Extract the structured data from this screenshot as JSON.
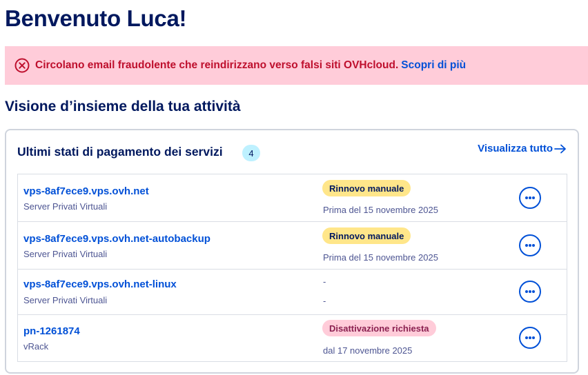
{
  "greeting": "Benvenuto Luca!",
  "alert": {
    "message": "Circolano email fraudolente che reindirizzano verso falsi siti OVHcloud.",
    "link": "Scopri di più",
    "color": "#be0f2d",
    "background": "#ffccd9",
    "icon": "error-circle-x-icon"
  },
  "section_title": "Visione d’insieme della tua attività",
  "payments_card": {
    "title": "Ultimi stati di pagamento dei servizi",
    "count": "4",
    "view_all": "Visualizza tutto",
    "rows": [
      {
        "name": "vps-8af7ece9.vps.ovh.net",
        "type": "Server Privati Virtuali",
        "status": "Rinnovo manuale",
        "status_color": "#ffe68a",
        "date": "Prima del 15 novembre 2025"
      },
      {
        "name": "vps-8af7ece9.vps.ovh.net-autobackup",
        "type": "Server Privati Virtuali",
        "status": "Rinnovo manuale",
        "status_color": "#ffe68a",
        "date": "Prima del 15 novembre 2025"
      },
      {
        "name": "vps-8af7ece9.vps.ovh.net-linux",
        "type": "Server Privati Virtuali",
        "status": "-",
        "date": "-"
      },
      {
        "name": "pn-1261874",
        "type": "vRack",
        "status": "Disattivazione richiesta",
        "status_color": "#ffccd9",
        "date": "dal 17 novembre 2025"
      }
    ]
  }
}
